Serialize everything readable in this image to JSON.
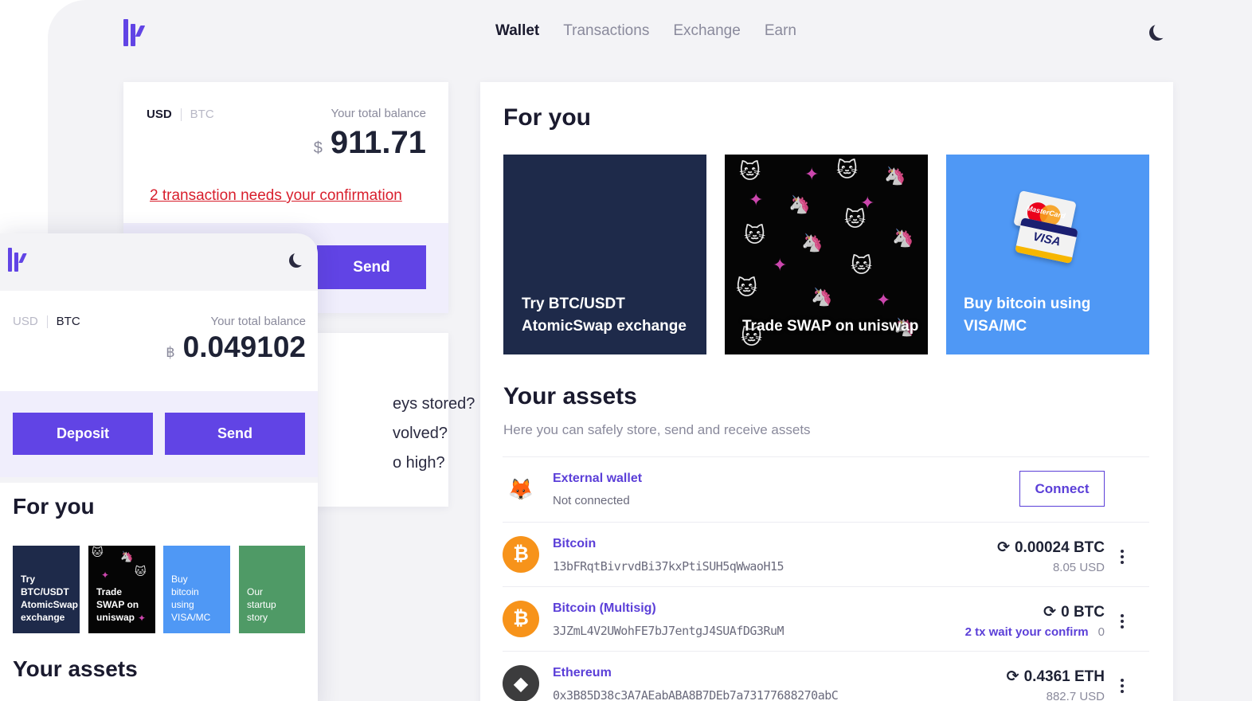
{
  "nav": {
    "items": [
      "Wallet",
      "Transactions",
      "Exchange",
      "Earn"
    ],
    "active": "Wallet"
  },
  "balance": {
    "tab_usd": "USD",
    "tab_btc": "BTC",
    "label": "Your total balance",
    "currency_symbol": "$",
    "amount": "911.71",
    "confirmation_link": "2 transaction needs your confirmation",
    "send_label": "Send"
  },
  "faq": {
    "items": [
      "eys stored?",
      "volved?",
      "o high?"
    ]
  },
  "for_you": {
    "title": "For you",
    "cards": [
      {
        "text_line1": "Try BTC/USDT",
        "text_line2": "AtomicSwap exchange"
      },
      {
        "text_line1": "Trade SWAP on uniswap"
      },
      {
        "text_line1": "Buy bitcoin using",
        "text_line2": "VISA/MC",
        "card_logo_1": "MasterCard",
        "card_logo_2": "VISA"
      }
    ]
  },
  "assets": {
    "title": "Your assets",
    "subtitle": "Here you can safely store, send and receive assets",
    "external": {
      "name": "External wallet",
      "status": "Not connected",
      "connect_label": "Connect"
    },
    "rows": [
      {
        "name": "Bitcoin",
        "address": "13bFRqtBivrvdBi37kxPtiSUH5qWwaoH15",
        "amount": "0.00024 BTC",
        "sub": "8.05 USD",
        "icon": "bitcoin-icon"
      },
      {
        "name": "Bitcoin (Multisig)",
        "address": "3JZmL4V2UWohFE7bJ7entgJ4SUAfDG3RuM",
        "amount": "0 BTC",
        "wait": "2 tx wait your confirm",
        "sub": "0",
        "icon": "bitcoin-icon"
      },
      {
        "name": "Ethereum",
        "address": "0x3B85D38c3A7AEabABA8B7DEb7a73177688270abC",
        "amount": "0.4361 ETH",
        "sub": "882.7 USD",
        "icon": "ethereum-icon"
      }
    ]
  },
  "mobile": {
    "tab_usd": "USD",
    "tab_btc": "BTC",
    "label": "Your total balance",
    "currency_symbol": "฿",
    "amount": "0.049102",
    "deposit_label": "Deposit",
    "send_label": "Send",
    "for_you_title": "For you",
    "cards": [
      "Try BTC/USDT AtomicSwap exchange",
      "Trade SWAP on uniswap",
      "Buy bitcoin using VISA/MC",
      "Our startup story"
    ],
    "card_lines": [
      [
        "Try",
        "BTC/USDT",
        "AtomicSwap",
        "exchange"
      ],
      [
        "Trade",
        "SWAP on",
        "uniswap"
      ],
      [
        "Buy",
        "bitcoin",
        "using",
        "VISA/MC"
      ],
      [
        "Our",
        "startup",
        "story"
      ]
    ],
    "assets_title": "Your assets"
  },
  "colors": {
    "accent": "#6144e5",
    "alert": "#d81e2c",
    "btc": "#f7931a",
    "blue_card": "#4f98f5",
    "navy_card": "#1e2a4a",
    "green_card": "#4f9a66"
  }
}
